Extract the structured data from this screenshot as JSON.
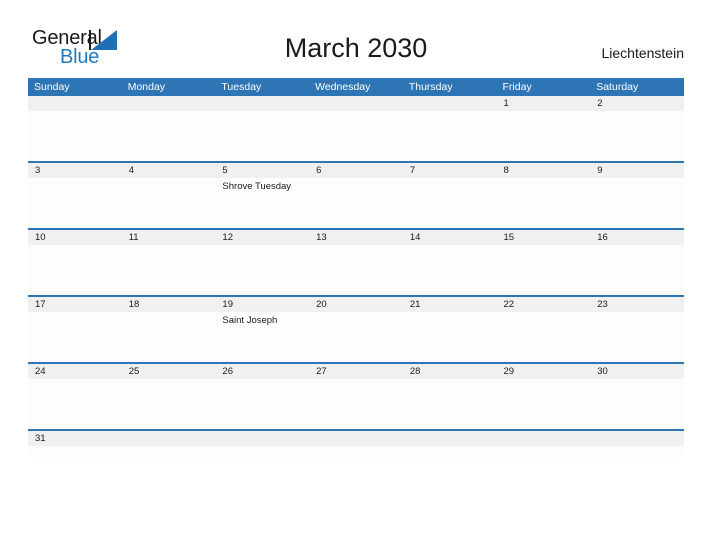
{
  "brand": {
    "name_part1": "General",
    "name_part2": "Blue",
    "triangle_icon": "flag-triangle-icon",
    "accent_color": "#1f7bc1"
  },
  "header": {
    "title": "March 2030",
    "country": "Liechtenstein"
  },
  "colors": {
    "header_blue": "#2e75b6",
    "row_gray": "#f0f0f0",
    "body_white": "#fdfdfd",
    "text": "#1a1a1a"
  },
  "calendar": {
    "month": "March",
    "year": "2030",
    "weekdays": [
      "Sunday",
      "Monday",
      "Tuesday",
      "Wednesday",
      "Thursday",
      "Friday",
      "Saturday"
    ],
    "weeks": [
      {
        "days": [
          {
            "num": "",
            "event": ""
          },
          {
            "num": "",
            "event": ""
          },
          {
            "num": "",
            "event": ""
          },
          {
            "num": "",
            "event": ""
          },
          {
            "num": "",
            "event": ""
          },
          {
            "num": "1",
            "event": ""
          },
          {
            "num": "2",
            "event": ""
          }
        ]
      },
      {
        "days": [
          {
            "num": "3",
            "event": ""
          },
          {
            "num": "4",
            "event": ""
          },
          {
            "num": "5",
            "event": "Shrove Tuesday"
          },
          {
            "num": "6",
            "event": ""
          },
          {
            "num": "7",
            "event": ""
          },
          {
            "num": "8",
            "event": ""
          },
          {
            "num": "9",
            "event": ""
          }
        ]
      },
      {
        "days": [
          {
            "num": "10",
            "event": ""
          },
          {
            "num": "11",
            "event": ""
          },
          {
            "num": "12",
            "event": ""
          },
          {
            "num": "13",
            "event": ""
          },
          {
            "num": "14",
            "event": ""
          },
          {
            "num": "15",
            "event": ""
          },
          {
            "num": "16",
            "event": ""
          }
        ]
      },
      {
        "days": [
          {
            "num": "17",
            "event": ""
          },
          {
            "num": "18",
            "event": ""
          },
          {
            "num": "19",
            "event": "Saint Joseph"
          },
          {
            "num": "20",
            "event": ""
          },
          {
            "num": "21",
            "event": ""
          },
          {
            "num": "22",
            "event": ""
          },
          {
            "num": "23",
            "event": ""
          }
        ]
      },
      {
        "days": [
          {
            "num": "24",
            "event": ""
          },
          {
            "num": "25",
            "event": ""
          },
          {
            "num": "26",
            "event": ""
          },
          {
            "num": "27",
            "event": ""
          },
          {
            "num": "28",
            "event": ""
          },
          {
            "num": "29",
            "event": ""
          },
          {
            "num": "30",
            "event": ""
          }
        ]
      },
      {
        "days": [
          {
            "num": "31",
            "event": ""
          },
          {
            "num": "",
            "event": ""
          },
          {
            "num": "",
            "event": ""
          },
          {
            "num": "",
            "event": ""
          },
          {
            "num": "",
            "event": ""
          },
          {
            "num": "",
            "event": ""
          },
          {
            "num": "",
            "event": ""
          }
        ]
      }
    ]
  }
}
